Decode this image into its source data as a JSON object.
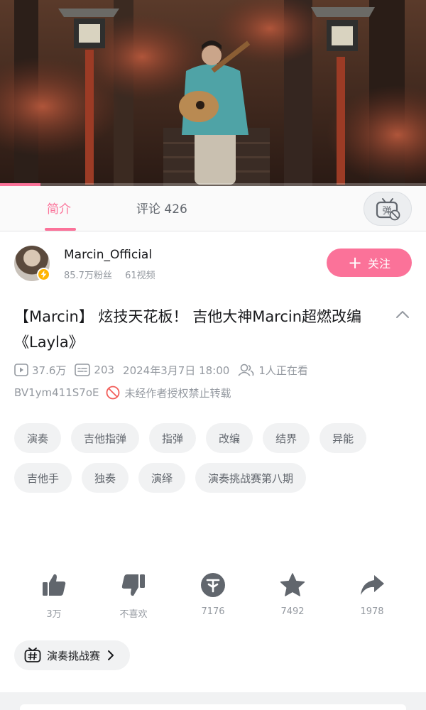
{
  "player": {
    "progress_fraction": 0.095
  },
  "tabs": {
    "intro": "简介",
    "comments": "评论 426",
    "danmaku_icon": "danmaku-off-icon"
  },
  "uploader": {
    "name": "Marcin_Official",
    "followers": "85.7万粉丝",
    "videos": "61视频",
    "follow_label": "关注"
  },
  "video": {
    "title": "【Marcin】 炫技天花板！ 吉他大神Marcin超燃改编《Layla》",
    "views": "37.6万",
    "danmaku_count": "203",
    "publish_time": "2024年3月7日 18:00",
    "watching": "1人正在看",
    "bvid": "BV1ym411S7oE",
    "copyright_notice": "未经作者授权禁止转载"
  },
  "tags": [
    "演奏",
    "吉他指弹",
    "指弹",
    "改编",
    "结界",
    "异能",
    "吉他手",
    "独奏",
    "演绎",
    "演奏挑战赛第八期"
  ],
  "actions": {
    "like": "3万",
    "dislike": "不喜欢",
    "coin": "7176",
    "favorite": "7492",
    "share": "1978"
  },
  "topic": {
    "label": "演奏挑战赛"
  },
  "colors": {
    "accent": "#fb7299",
    "muted_text": "#9499a0",
    "tag_bg": "#f1f2f3",
    "icon_gray": "#61666d",
    "badge": "#ffb400"
  }
}
